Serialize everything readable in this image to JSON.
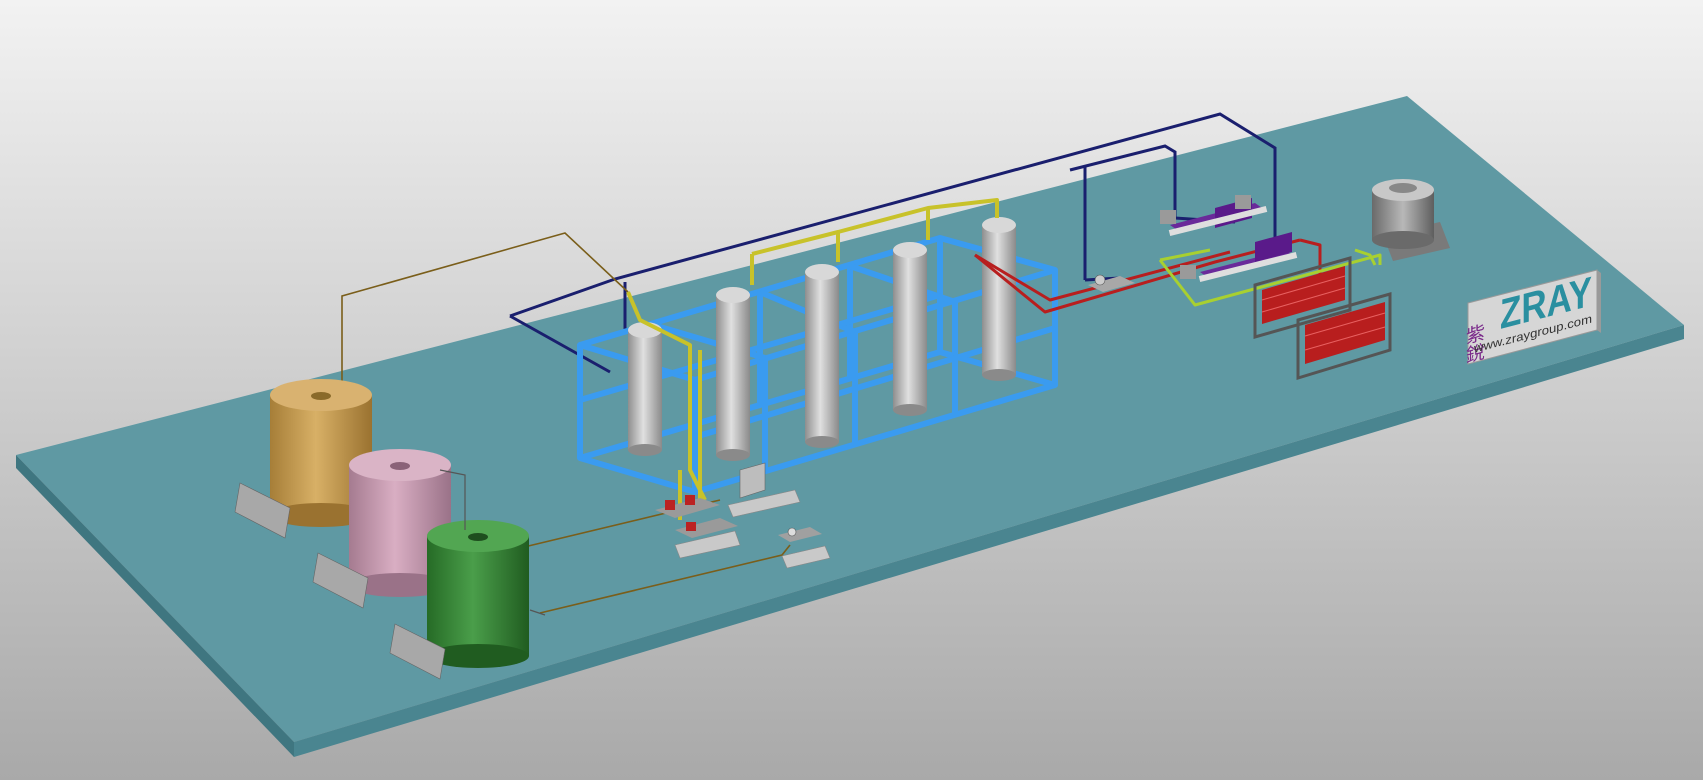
{
  "logo": {
    "chinese": "紫銳",
    "brand": "ZRAY",
    "website": "www.zraygroup.com"
  },
  "colors": {
    "background_top": "#f0f0f0",
    "background_bottom": "#a8a8a8",
    "platform_top": "#5f99a3",
    "platform_side": "#3f7680",
    "frame_blue": "#3a9bf0",
    "pipe_navy": "#1a1f6e",
    "pipe_yellow": "#c8c22a",
    "pipe_olive": "#7a5e1a",
    "pipe_red": "#b81e1e",
    "pipe_lime": "#a8d030",
    "tank_tan": "#c8a050",
    "tank_pink": "#c89ab0",
    "tank_green": "#3c8a3c",
    "column_grey": "#c6c6c6",
    "exchanger_purple": "#5a1a8a",
    "logo_purple": "#7a2a8a",
    "logo_teal": "#2a8fa0"
  },
  "icons": [
    "cooling-tower-icon",
    "pump-icon",
    "heat-exchanger-icon"
  ]
}
